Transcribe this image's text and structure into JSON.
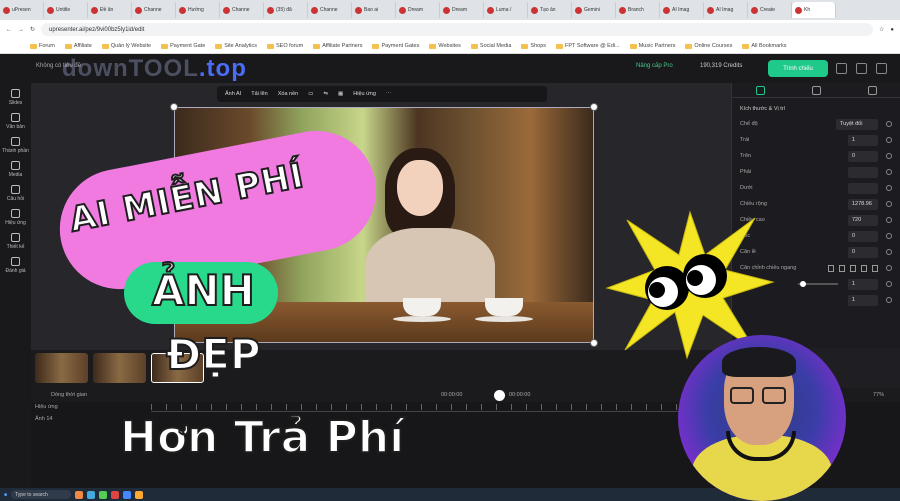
{
  "browser": {
    "tabs": [
      "uPresen",
      "Untitle",
      "Đề ăn",
      "Channe",
      "Hướng",
      "Channe",
      "(35) đã",
      "Channe",
      "Bao ai",
      "Dream",
      "Dream",
      "Luma /",
      "Tạo ản",
      "Gemini",
      "Branch",
      "AI Imag",
      "AI Imag",
      "Create",
      "Kh"
    ],
    "url": "upresenter.ai/pez/9vi00bz5ly1id/edit",
    "bookmarks": [
      "Forum",
      "Affiliate",
      "Quản lý Website",
      "Payment Gate",
      "Site Analytics",
      "SEO forum",
      "Affiliate Partners",
      "Payment Gates",
      "Websites",
      "Social Media",
      "Shops",
      "FPT Software @ Edi...",
      "Music Partners",
      "Online Courses",
      "All Bookmarks"
    ]
  },
  "app": {
    "project_name": "Không có tiêu đề",
    "watermark_main": "downTOOL",
    "watermark_tld": ".top",
    "upgrade_label": "Nâng cấp Pro",
    "credits": "190,319 Credits",
    "present_label": "Trình chiếu"
  },
  "left_nav": [
    "Slides",
    "Văn bản",
    "Thành phần",
    "Media",
    "Câu hỏi",
    "Hiệu ứng",
    "Thiết kế",
    "Đánh giá"
  ],
  "toolbar": [
    "Ảnh AI",
    "Tải lên",
    "Xóa nền",
    "Hiệu ứng"
  ],
  "panel": {
    "section_title": "Kích thước & Vị trí",
    "rows": [
      {
        "label": "Chế độ",
        "value": "Tuyệt đối"
      },
      {
        "label": "Trái",
        "value": "1"
      },
      {
        "label": "Trên",
        "value": "0"
      },
      {
        "label": "Phải",
        "value": ""
      },
      {
        "label": "Dưới",
        "value": ""
      },
      {
        "label": "Chiều rộng",
        "value": "1278.96"
      },
      {
        "label": "Chiều cao",
        "value": "720"
      },
      {
        "label": "Góc",
        "value": "0"
      },
      {
        "label": "Căn lề",
        "value": "0"
      },
      {
        "label": "Căn chỉnh chiều ngang",
        "value": ""
      },
      {
        "label": "Phóng to",
        "value": "1"
      },
      {
        "label": "",
        "value": "1"
      }
    ]
  },
  "player": {
    "timeline_label": "Dòng thời gian",
    "current_time": "00:00:00",
    "total_time": "00:00:00",
    "zoom": "77%"
  },
  "timeline": {
    "track_label": "Hiệu ứng",
    "layer_label": "Ảnh 14"
  },
  "taskbar": {
    "search_placeholder": "Type to search"
  },
  "overlay": {
    "line1": "AI MIỄN PHÍ",
    "line2": "ẢNH",
    "line3": "ĐẸP",
    "line4": "Hơn Trả Phí"
  },
  "colors": {
    "accent_green": "#1ec98a",
    "pink_pill": "#f07ae0",
    "green_pill": "#28d98c",
    "burst_yellow": "#f5e625"
  }
}
